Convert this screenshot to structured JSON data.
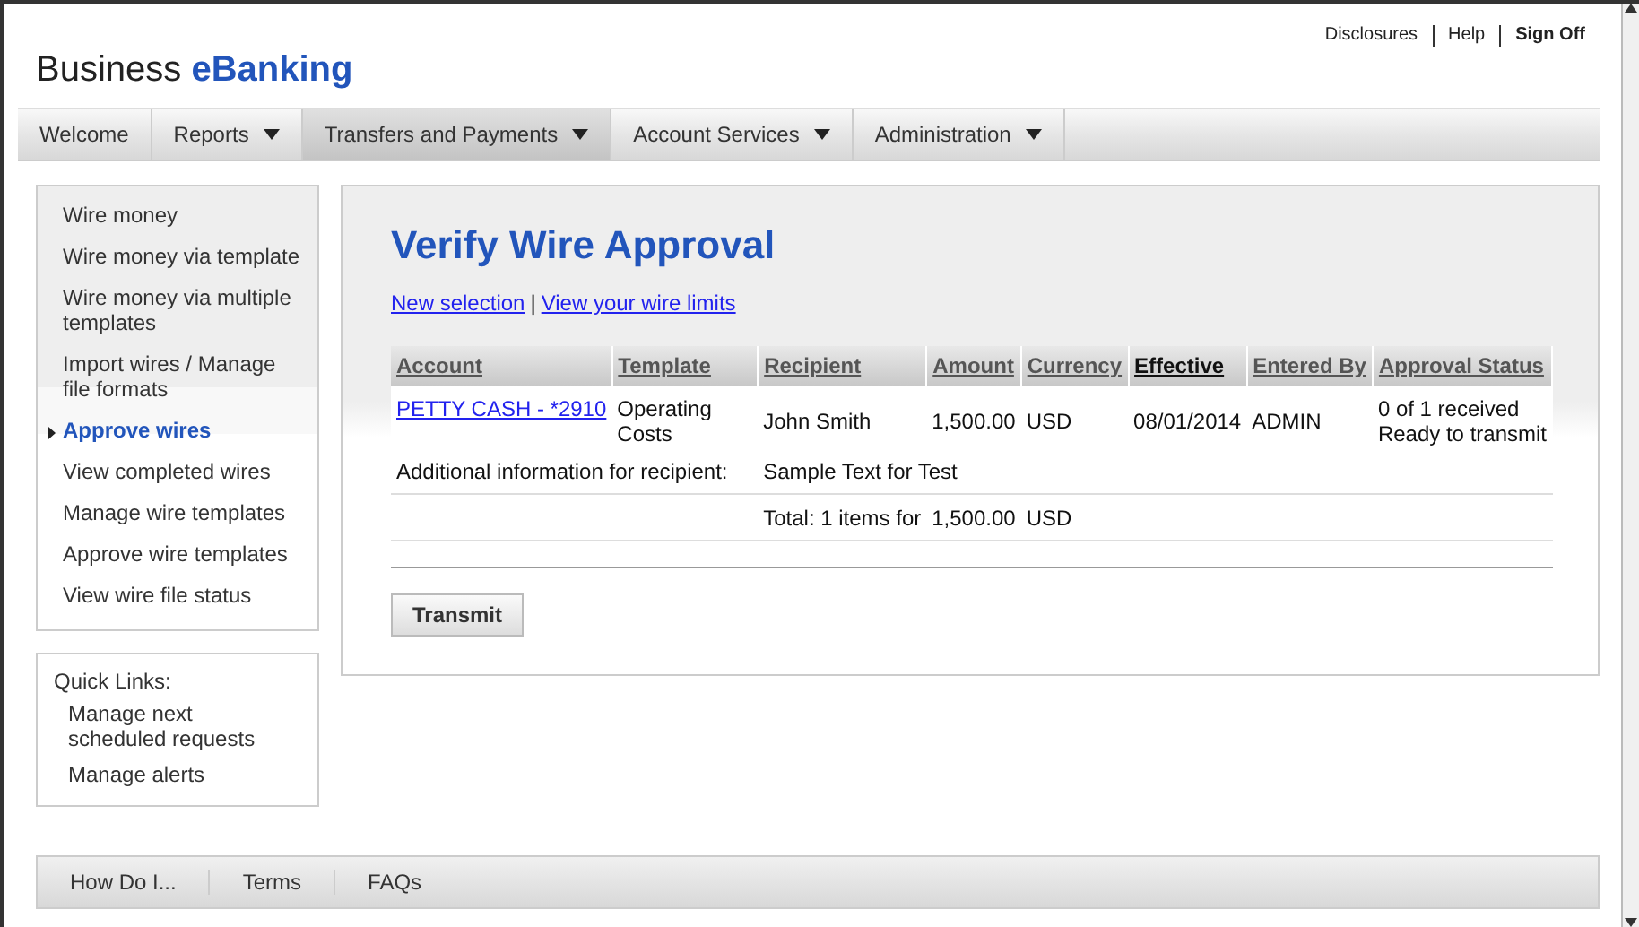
{
  "header": {
    "brand_plain": "Business",
    "brand_accent": "eBanking",
    "utility_links": [
      "Disclosures",
      "Help",
      "Sign Off"
    ]
  },
  "nav": [
    {
      "label": "Welcome",
      "has_menu": false,
      "selected": false
    },
    {
      "label": "Reports",
      "has_menu": true,
      "selected": false
    },
    {
      "label": "Transfers and Payments",
      "has_menu": true,
      "selected": true
    },
    {
      "label": "Account Services",
      "has_menu": true,
      "selected": false
    },
    {
      "label": "Administration",
      "has_menu": true,
      "selected": false
    }
  ],
  "sidebar": {
    "items": [
      {
        "label": "Wire money",
        "selected": false
      },
      {
        "label": "Wire money via template",
        "selected": false
      },
      {
        "label": "Wire money via multiple templates",
        "selected": false
      },
      {
        "label": "Import wires / Manage file formats",
        "selected": false
      },
      {
        "label": "Approve wires",
        "selected": true
      },
      {
        "label": "View completed wires",
        "selected": false
      },
      {
        "label": "Manage wire templates",
        "selected": false
      },
      {
        "label": "Approve wire templates",
        "selected": false
      },
      {
        "label": "View wire file status",
        "selected": false
      }
    ]
  },
  "quick_links": {
    "title": "Quick Links:",
    "items": [
      "Manage next scheduled requests",
      "Manage alerts"
    ]
  },
  "main": {
    "title": "Verify Wire Approval",
    "links": [
      "New selection",
      "View your wire limits"
    ],
    "link_separator": "|",
    "table": {
      "columns": [
        {
          "label": "Account",
          "sorted": false
        },
        {
          "label": "Template",
          "sorted": false
        },
        {
          "label": "Recipient",
          "sorted": false
        },
        {
          "label": "Amount",
          "sorted": false
        },
        {
          "label": "Currency",
          "sorted": false
        },
        {
          "label": "Effective",
          "sorted": true
        },
        {
          "label": "Entered By",
          "sorted": false
        },
        {
          "label": "Approval Status",
          "sorted": false
        }
      ],
      "rows": [
        {
          "account": "PETTY CASH - *2910",
          "template": "Operating Costs",
          "recipient": "John Smith",
          "amount": "1,500.00",
          "currency": "USD",
          "effective": "08/01/2014",
          "entered_by": "ADMIN",
          "status": [
            "0 of 1 received",
            "Ready to transmit"
          ],
          "info_label": "Additional information for recipient:",
          "info_value": "Sample Text for Test"
        }
      ],
      "total": {
        "label": "Total: 1 items for",
        "amount": "1,500.00",
        "currency": "USD"
      }
    },
    "button": "Transmit"
  },
  "footer": [
    "How Do I...",
    "Terms",
    "FAQs"
  ]
}
